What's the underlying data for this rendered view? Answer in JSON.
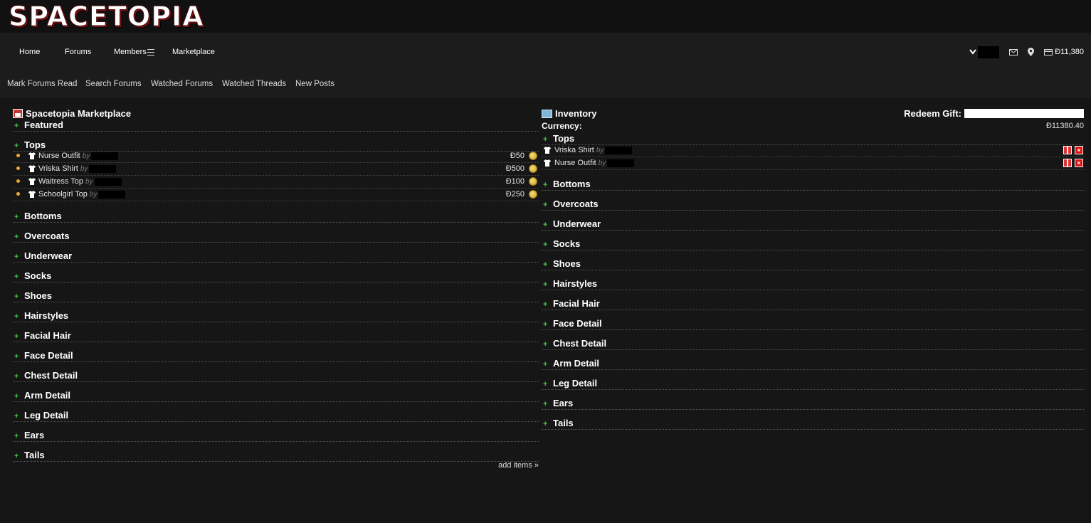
{
  "header": {
    "logo": "SPACETOPIA"
  },
  "nav": {
    "items": [
      "Home",
      "Forums",
      "Members",
      "Marketplace"
    ],
    "balance": "Đ11,380"
  },
  "subnav": [
    "Mark Forums Read",
    "Search Forums",
    "Watched Forums",
    "Watched Threads",
    "New Posts"
  ],
  "marketplace": {
    "title": "Spacetopia Marketplace",
    "featured": "Featured",
    "tops": "Tops",
    "items": [
      {
        "name": "Nurse Outfit",
        "by": "by",
        "price": "Đ50"
      },
      {
        "name": "Vriska Shirt",
        "by": "by",
        "price": "Đ500"
      },
      {
        "name": "Waitress Top",
        "by": "by",
        "price": "Đ100"
      },
      {
        "name": "Schoolgirl Top",
        "by": "by",
        "price": "Đ250"
      }
    ],
    "categories": [
      "Bottoms",
      "Overcoats",
      "Underwear",
      "Socks",
      "Shoes",
      "Hairstyles",
      "Facial Hair",
      "Face Detail",
      "Chest Detail",
      "Arm Detail",
      "Leg Detail",
      "Ears",
      "Tails"
    ],
    "add_items": "add items »"
  },
  "inventory": {
    "title": "Inventory",
    "redeem_label": "Redeem Gift:",
    "currency_label": "Currency:",
    "currency_value": "Đ11380.40",
    "tops": "Tops",
    "items": [
      {
        "name": "Vriska Shirt",
        "by": "by"
      },
      {
        "name": "Nurse Outfit",
        "by": "by"
      }
    ],
    "categories": [
      "Bottoms",
      "Overcoats",
      "Underwear",
      "Socks",
      "Shoes",
      "Hairstyles",
      "Facial Hair",
      "Face Detail",
      "Chest Detail",
      "Arm Detail",
      "Leg Detail",
      "Ears",
      "Tails"
    ]
  }
}
